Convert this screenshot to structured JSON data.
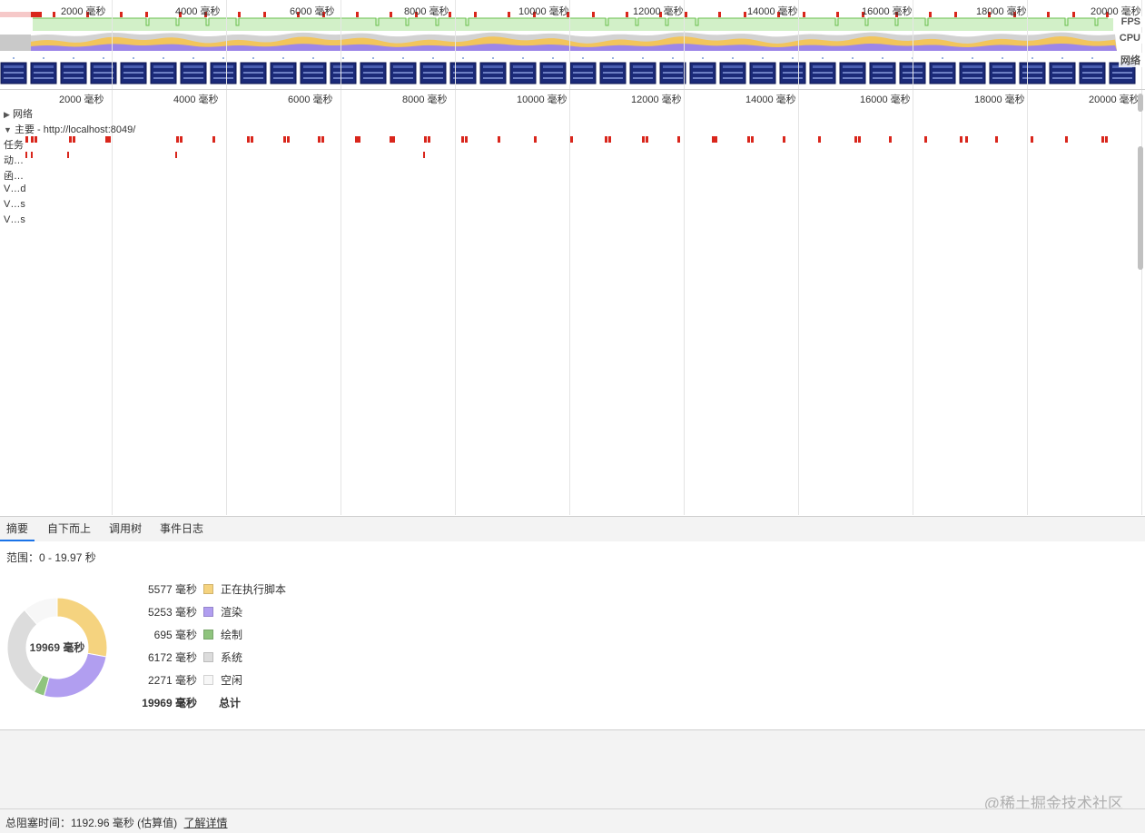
{
  "overview": {
    "ticks": [
      "2000 毫秒",
      "4000 毫秒",
      "6000 毫秒",
      "8000 毫秒",
      "10000 毫秒",
      "12000 毫秒",
      "14000 毫秒",
      "16000 毫秒",
      "18000 毫秒",
      "20000 毫秒"
    ],
    "track_labels": {
      "fps": "FPS",
      "cpu": "CPU",
      "network": "网络"
    }
  },
  "timeline": {
    "ticks": [
      "2000 毫秒",
      "4000 毫秒",
      "6000 毫秒",
      "8000 毫秒",
      "10000 毫秒",
      "12000 毫秒",
      "14000 毫秒",
      "16000 毫秒",
      "18000 毫秒",
      "20000 毫秒"
    ],
    "network_label": "网络",
    "main_label": "主要 - http://localhost:8049/",
    "rows": [
      "任务",
      "动…",
      "函…",
      "V…d",
      "V…s",
      "V…s"
    ],
    "network_expand_icon": "triangle-right-icon",
    "main_expand_icon": "triangle-down-icon"
  },
  "tabs": [
    "摘要",
    "自下而上",
    "调用树",
    "事件日志"
  ],
  "summary": {
    "range": "范围：0 - 19.97 秒",
    "donut_center": "19969 毫秒",
    "legend": [
      {
        "value": "5577 毫秒",
        "label": "正在执行脚本",
        "color": "#f5d37f",
        "ms": 5577
      },
      {
        "value": "5253 毫秒",
        "label": "渲染",
        "color": "#b19ef0",
        "ms": 5253
      },
      {
        "value": "695 毫秒",
        "label": "绘制",
        "color": "#8fc47e",
        "ms": 695
      },
      {
        "value": "6172 毫秒",
        "label": "系统",
        "color": "#dcdcdc",
        "ms": 6172
      },
      {
        "value": "2271 毫秒",
        "label": "空闲",
        "color": "#f7f7f7",
        "ms": 2271
      }
    ],
    "total_value": "19969 毫秒",
    "total_label": "总计"
  },
  "footer": {
    "blocking_text": "总阻塞时间：1192.96 毫秒 (估算值)",
    "learn_more": "了解详情"
  },
  "watermark": "@稀土掘金技术社区",
  "colors": {
    "accent": "#1a73e8",
    "long_task": "#d9261c",
    "fps_fill": "#d2f0c8",
    "fps_line": "#6bbf4e"
  }
}
